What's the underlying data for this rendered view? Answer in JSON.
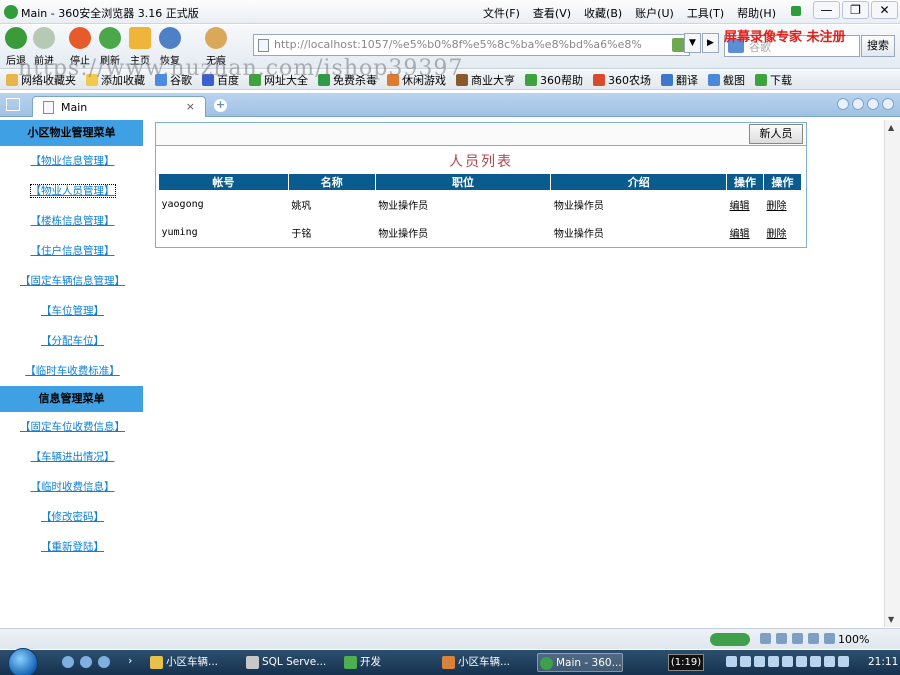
{
  "window": {
    "title": "Main - 360安全浏览器 3.16 正式版",
    "menu": [
      "文件(F)",
      "查看(V)",
      "收藏(B)",
      "账户(U)",
      "工具(T)",
      "帮助(H)"
    ],
    "controls": [
      "—",
      "❐",
      "✕"
    ]
  },
  "navbar": {
    "buttons": [
      "后退",
      "前进",
      "停止",
      "刷新",
      "主页",
      "恢复",
      "无痕"
    ],
    "address": "http://localhost:1057/%e5%b0%8f%e5%8c%ba%e8%bd%a6%e8%",
    "search_placeholder": "谷歌",
    "search_label": "搜索",
    "watermark_text": "屏幕录像专家  未注册",
    "watermark_url": "https://www.huzhan.com/ishop39397"
  },
  "favorites": [
    "网络收藏夹",
    "添加收藏",
    "谷歌",
    "百度",
    "网址大全",
    "免费杀毒",
    "休闲游戏",
    "商业大亨",
    "360帮助",
    "360农场",
    "翻译",
    "截图",
    "下载"
  ],
  "tab": {
    "label": "Main",
    "close": "×",
    "new": "+"
  },
  "sidebar": {
    "section1": {
      "title": "小区物业管理菜单",
      "items": [
        "【物业信息管理】",
        "【物业人员管理】",
        "【楼栋信息管理】",
        "【住户信息管理】",
        "【固定车辆信息管理】",
        "【车位管理】",
        "【分配车位】",
        "【临时车收费标准】"
      ]
    },
    "section2": {
      "title": "信息管理菜单",
      "items": [
        "【固定车位收费信息】",
        "【车辆进出情况】",
        "【临时收费信息】",
        "【修改密码】",
        "【重新登陆】"
      ]
    }
  },
  "main": {
    "new_button": "新人员",
    "list_title": "人员列表",
    "columns": [
      "帐号",
      "名称",
      "职位",
      "介绍",
      "操作",
      "操作"
    ],
    "rows": [
      {
        "account": "yaogong",
        "name": "姚巩",
        "position": "物业操作员",
        "intro": "物业操作员",
        "edit": "编辑",
        "delete": "删除"
      },
      {
        "account": "yuming",
        "name": "于铭",
        "position": "物业操作员",
        "intro": "物业操作员",
        "edit": "编辑",
        "delete": "删除"
      }
    ]
  },
  "statusbar": {
    "zoom": "100%"
  },
  "taskbar": {
    "tasks": [
      "小区车辆...",
      "SQL Serve...",
      "开发",
      "小区车辆...",
      "Main - 360..."
    ],
    "recorder_time": "(1:19)",
    "clock": "21:11"
  }
}
